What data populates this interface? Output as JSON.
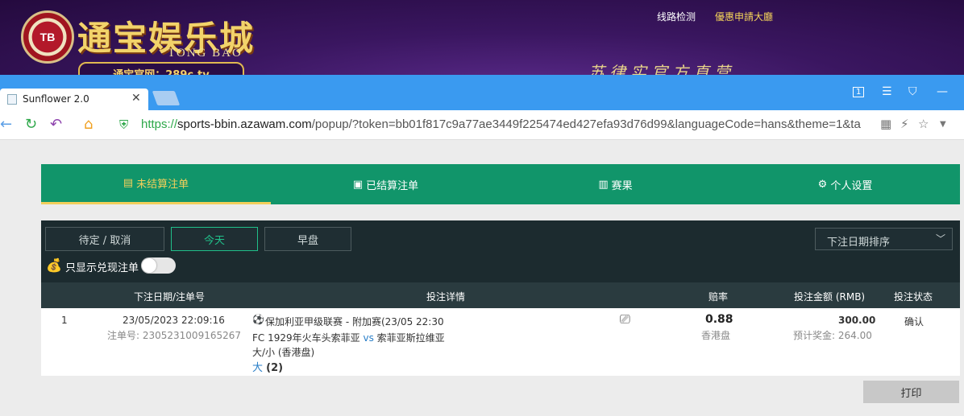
{
  "banner": {
    "logo_badge": "TB",
    "logo_title": "通宝娱乐城",
    "logo_sub": "TONG BAO",
    "site_url": "通宝官网：289c.tv",
    "nav_line_check": "线路检测",
    "nav_promo": "優惠申請大廳",
    "slogan": "苏律实官方直营"
  },
  "browser": {
    "tab_title": "Sunflower 2.0",
    "url_scheme": "https://",
    "url_host": "sports-bbin.azawam.com",
    "url_path": "/popup/?token=bb01f817c9a77ae3449f225474ed427efa93d76d99&languageCode=hans&theme=1&ta"
  },
  "menu": {
    "unsettled": "未结算注单",
    "settled": "已结算注单",
    "results": "赛果",
    "settings": "个人设置"
  },
  "filters": {
    "pending": "待定 / 取消",
    "today": "今天",
    "early": "早盘",
    "sort": "下注日期排序",
    "cashout_only": "只显示兑现注单"
  },
  "table": {
    "headers": {
      "date_id": "下注日期/注单号",
      "details": "投注详情",
      "odds": "赔率",
      "amount": "投注金额 (RMB)",
      "status": "投注状态"
    },
    "rows": [
      {
        "index": "1",
        "datetime": "23/05/2023 22:09:16",
        "bet_id": "注单号: 2305231009165267",
        "league": "保加利亚甲级联赛 - 附加赛(23/05 22:30",
        "home": "FC 1929年火车头索菲亚",
        "vs": "vs",
        "away": "索菲亚斯拉维亚",
        "market": "大/小 (香港盘)",
        "pick": "大",
        "line": "(2)",
        "odds": "0.88",
        "odds_type": "香港盘",
        "stake": "300.00",
        "payout": "预计奖金: 264.00",
        "status": "确认"
      }
    ]
  },
  "print_label": "打印",
  "colors": {
    "menu_bg": "#11956a",
    "active_menu": "#f2cf5b",
    "panel_bg": "#1c2b2f",
    "accent_green": "#20c08a",
    "browser_blue": "#3a9af0"
  }
}
